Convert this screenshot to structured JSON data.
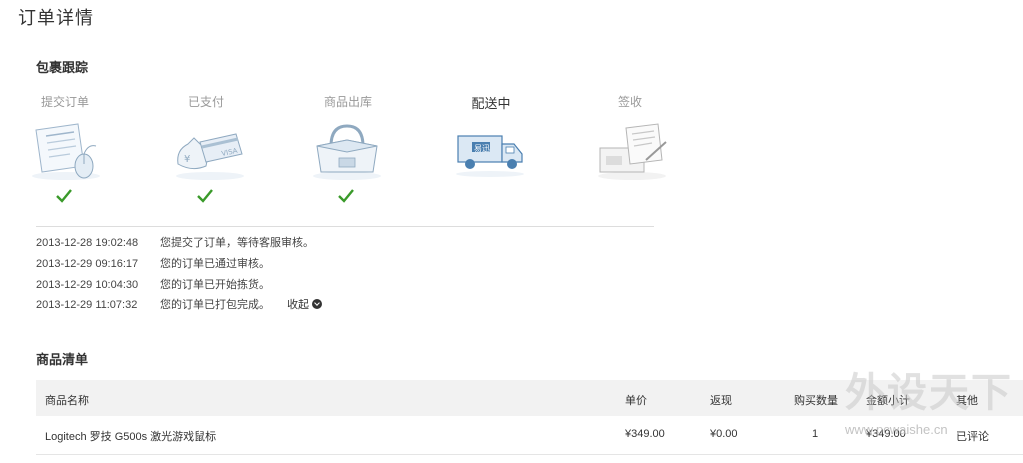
{
  "page": {
    "title": "订单详情"
  },
  "tracking": {
    "title": "包裹跟踪",
    "steps": [
      {
        "label": "提交订单",
        "icon": "order-form-icon",
        "done": true
      },
      {
        "label": "已支付",
        "icon": "payment-card-icon",
        "done": true
      },
      {
        "label": "商品出库",
        "icon": "warehouse-box-icon",
        "done": true
      },
      {
        "label": "配送中",
        "icon": "delivery-truck-icon",
        "done": false,
        "active": true
      },
      {
        "label": "签收",
        "icon": "signed-document-icon",
        "done": false
      }
    ],
    "logs": [
      {
        "time": "2013-12-28 19:02:48",
        "message": "您提交了订单，等待客服审核。"
      },
      {
        "time": "2013-12-29 09:16:17",
        "message": "您的订单已通过审核。"
      },
      {
        "time": "2013-12-29 10:04:30",
        "message": "您的订单已开始拣货。"
      },
      {
        "time": "2013-12-29 11:07:32",
        "message": "您的订单已打包完成。"
      }
    ],
    "collapse_label": "收起"
  },
  "items": {
    "title": "商品清单",
    "columns": [
      "商品名称",
      "单价",
      "返现",
      "购买数量",
      "金额小计",
      "其他"
    ],
    "rows": [
      {
        "name": "Logitech 罗技 G500s 激光游戏鼠标",
        "price": "¥349.00",
        "cashback": "¥0.00",
        "qty": "1",
        "subtotal": "¥349.00",
        "other": "已评论"
      }
    ]
  },
  "truck_brand": "易迅",
  "watermark": {
    "text": "外设天下",
    "url": "www.pcwaishe.cn"
  },
  "colors": {
    "check": "#3a9a2a",
    "header_bg": "#f2f2f2",
    "muted": "#999999"
  }
}
